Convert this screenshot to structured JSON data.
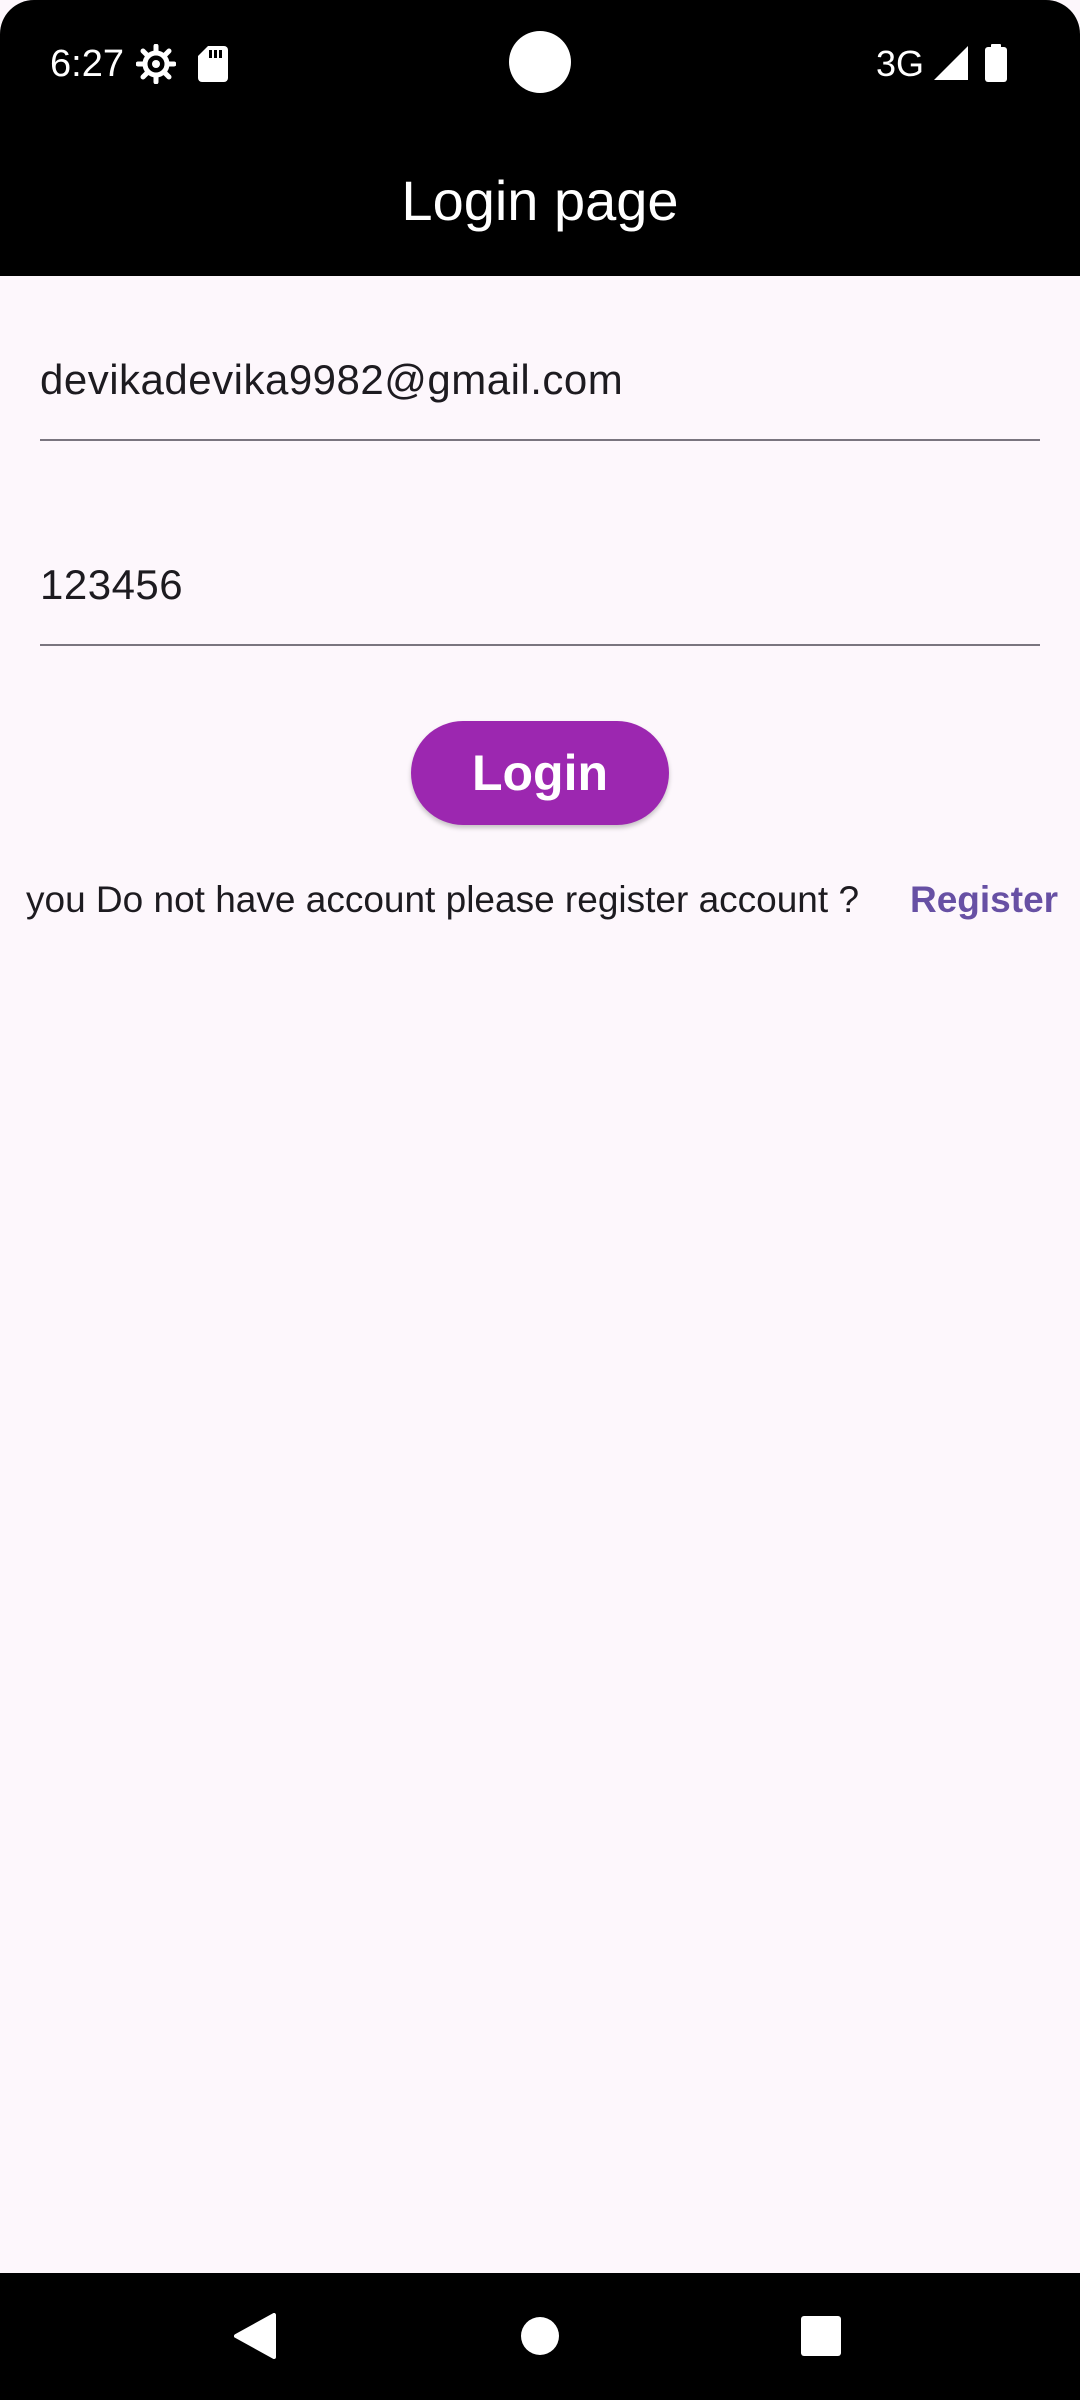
{
  "status_bar": {
    "time": "6:27",
    "network": "3G",
    "icons": [
      "gear-icon",
      "sd-card-icon",
      "signal-icon",
      "battery-icon"
    ]
  },
  "app_bar": {
    "title": "Login page"
  },
  "form": {
    "email_value": "devikadevika9982@gmail.com",
    "password_value": "123456",
    "login_label": "Login"
  },
  "register": {
    "prompt": "you Do not have account please register account ?",
    "link_label": "Register"
  },
  "nav_bar": {
    "icons": [
      "back-icon",
      "home-icon",
      "recents-icon"
    ]
  },
  "colors": {
    "background": "#FDF7FC",
    "button": "#9C27B0",
    "link": "#6750A4",
    "bars": "#000000"
  }
}
